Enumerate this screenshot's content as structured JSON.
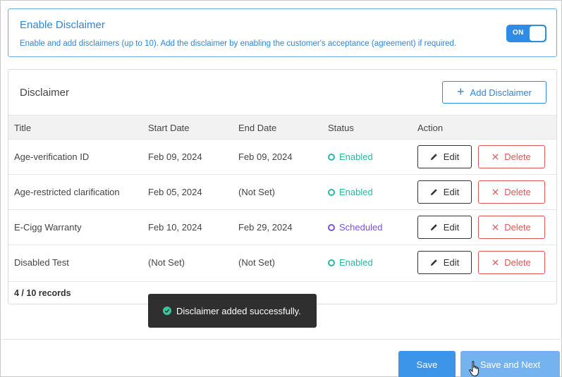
{
  "enable_section": {
    "title": "Enable Disclaimer",
    "description": "Enable and add disclaimers (up to 10). Add the disclaimer by enabling the customer's acceptance (agreement) if required.",
    "toggle_label": "ON"
  },
  "disclaimer_section": {
    "title": "Disclaimer",
    "add_button_label": "Add Disclaimer",
    "columns": {
      "title": "Title",
      "start_date": "Start Date",
      "end_date": "End Date",
      "status": "Status",
      "action": "Action"
    },
    "rows": [
      {
        "title": "Age-verification ID",
        "start_date": "Feb 09, 2024",
        "end_date": "Feb 09, 2024",
        "status": "Enabled"
      },
      {
        "title": "Age-restricted clarification",
        "start_date": "Feb 05, 2024",
        "end_date": "(Not Set)",
        "status": "Enabled"
      },
      {
        "title": "E-Cigg Warranty",
        "start_date": "Feb 10, 2024",
        "end_date": "Feb 29, 2024",
        "status": "Scheduled"
      },
      {
        "title": "Disabled Test",
        "start_date": "(Not Set)",
        "end_date": "(Not Set)",
        "status": "Enabled"
      }
    ],
    "edit_label": "Edit",
    "delete_label": "Delete",
    "records_count": "4 / 10 records"
  },
  "toast": {
    "message": "Disclaimer added successfully."
  },
  "footer": {
    "save_label": "Save",
    "save_next_label": "Save and Next"
  },
  "colors": {
    "primary": "#2f8ce6",
    "enabled": "#2bb7a3",
    "scheduled": "#7b52d8",
    "delete": "#e05656"
  }
}
